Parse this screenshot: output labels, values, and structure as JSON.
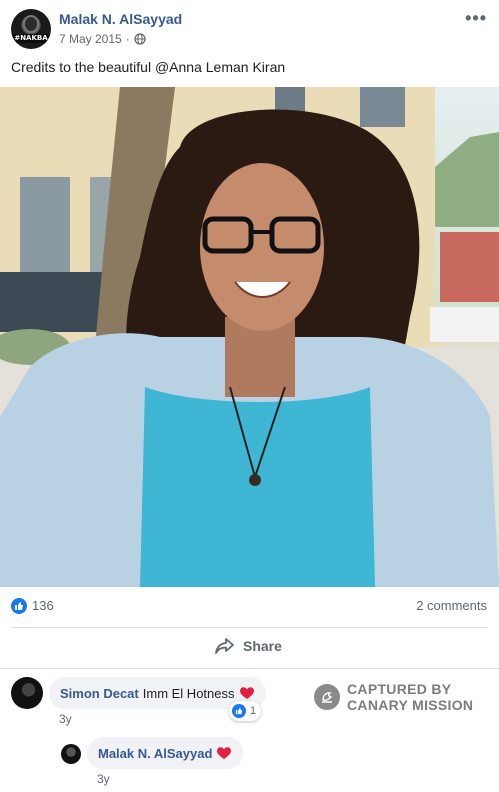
{
  "post": {
    "author": "Malak N. AlSayyad",
    "date": "7 May 2015",
    "privacy_icon": "globe-icon",
    "more_label": "•••",
    "caption": "Credits to the beautiful @Anna Leman Kiran",
    "avatar_badge": "#NAKBA"
  },
  "stats": {
    "like_count": "136",
    "comments_count": "2 comments"
  },
  "actions": {
    "share_label": "Share"
  },
  "comments": [
    {
      "author": "Simon Decat",
      "text": "Imm El Hotness",
      "emoji": "heart",
      "time": "3y",
      "reaction_count": "1"
    },
    {
      "author": "Malak N. AlSayyad",
      "text": "",
      "emoji": "heart",
      "time": "3y"
    }
  ],
  "watermark": {
    "line1": "CAPTURED BY",
    "line2": "CANARY MISSION"
  },
  "colors": {
    "link": "#385898",
    "like_blue": "#1877f2",
    "heart_red": "#e41e3f",
    "muted": "#606770"
  }
}
